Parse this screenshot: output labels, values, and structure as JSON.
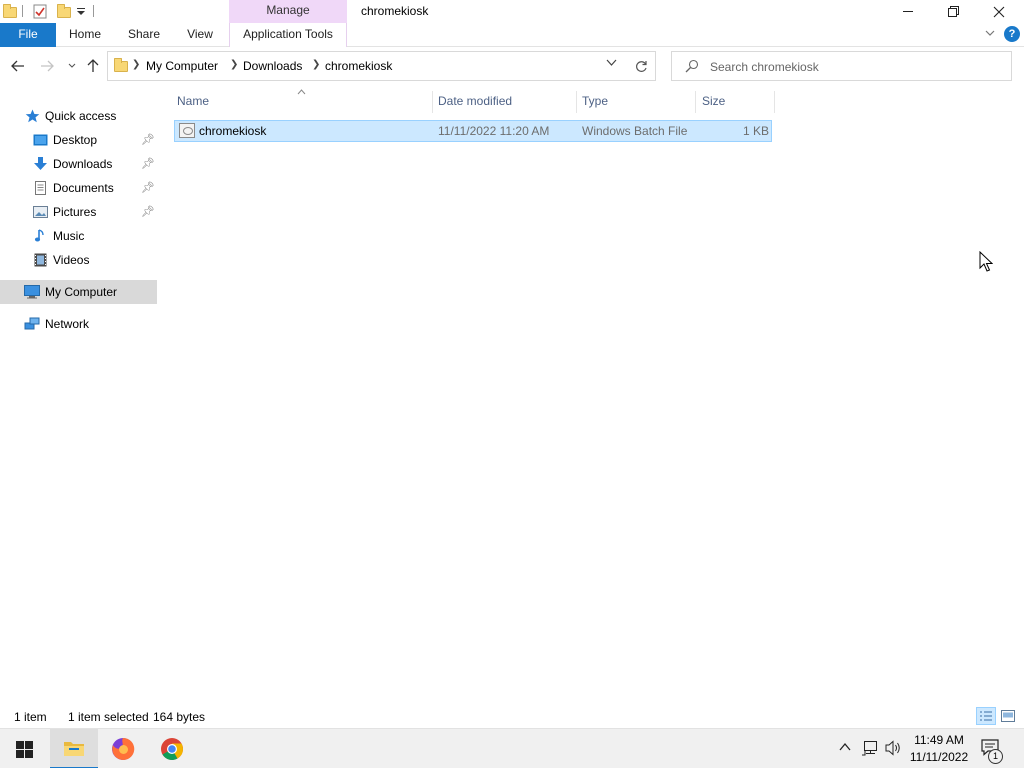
{
  "window": {
    "title": "chromekiosk",
    "context_tab_group": "Manage"
  },
  "ribbon": {
    "tabs": [
      {
        "label": "File"
      },
      {
        "label": "Home"
      },
      {
        "label": "Share"
      },
      {
        "label": "View"
      },
      {
        "label": "Application Tools"
      }
    ]
  },
  "address": {
    "breadcrumbs": [
      "My Computer",
      "Downloads",
      "chromekiosk"
    ]
  },
  "search": {
    "placeholder": "Search chromekiosk"
  },
  "sidebar": {
    "items": [
      {
        "label": "Quick access",
        "icon": "star-icon"
      },
      {
        "label": "Desktop",
        "icon": "desktop-folder-icon",
        "pinned": true
      },
      {
        "label": "Downloads",
        "icon": "download-arrow-icon",
        "pinned": true
      },
      {
        "label": "Documents",
        "icon": "documents-icon",
        "pinned": true
      },
      {
        "label": "Pictures",
        "icon": "pictures-icon",
        "pinned": true
      },
      {
        "label": "Music",
        "icon": "music-note-icon"
      },
      {
        "label": "Videos",
        "icon": "film-icon"
      },
      {
        "label": "My Computer",
        "icon": "computer-icon",
        "selected": true
      },
      {
        "label": "Network",
        "icon": "network-icon"
      }
    ]
  },
  "files": {
    "columns": [
      "Name",
      "Date modified",
      "Type",
      "Size"
    ],
    "rows": [
      {
        "name": "chromekiosk",
        "date_modified": "11/11/2022 11:20 AM",
        "type": "Windows Batch File",
        "size": "1 KB",
        "selected": true
      }
    ]
  },
  "status": {
    "item_count": "1 item",
    "selection": "1 item selected",
    "selection_size": "164 bytes"
  },
  "taskbar": {
    "apps": [
      "start-icon",
      "file-explorer-icon",
      "firefox-icon",
      "chrome-icon"
    ],
    "clock_time": "11:49 AM",
    "clock_date": "11/11/2022",
    "notification_count": "1"
  },
  "colors": {
    "accent": "#1979ca",
    "selection_bg": "#cce8ff",
    "selection_border": "#99d1ff",
    "manage_tab": "#f0d8f8"
  }
}
